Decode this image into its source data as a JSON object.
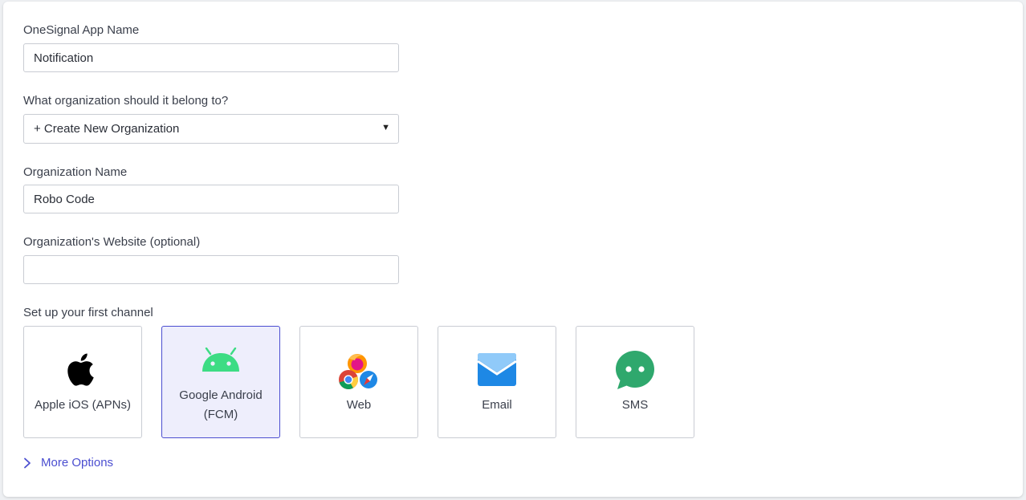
{
  "form": {
    "app_name": {
      "label": "OneSignal App Name",
      "value": "Notification"
    },
    "organization": {
      "label": "What organization should it belong to?",
      "selected": "+ Create New Organization",
      "caret": "▼"
    },
    "organization_name": {
      "label": "Organization Name",
      "value": "Robo Code"
    },
    "organization_website": {
      "label": "Organization's Website (optional)",
      "value": ""
    },
    "channel_section": {
      "label": "Set up your first channel",
      "channels": [
        {
          "label": "Apple iOS (APNs)",
          "icon": "apple-icon",
          "selected": false
        },
        {
          "label_line1": "Google Android",
          "label_line2": "(FCM)",
          "icon": "android-icon",
          "selected": true
        },
        {
          "label": "Web",
          "icon": "web-browsers-icon",
          "selected": false
        },
        {
          "label": "Email",
          "icon": "email-icon",
          "selected": false
        },
        {
          "label": "SMS",
          "icon": "sms-icon",
          "selected": false
        }
      ]
    },
    "more_options": "More Options"
  },
  "colors": {
    "accent": "#4b4ed0",
    "selected_bg": "#eeeefc",
    "android_green": "#3ddc84",
    "email_blue": "#1e88e5",
    "sms_green": "#2fa86d"
  }
}
